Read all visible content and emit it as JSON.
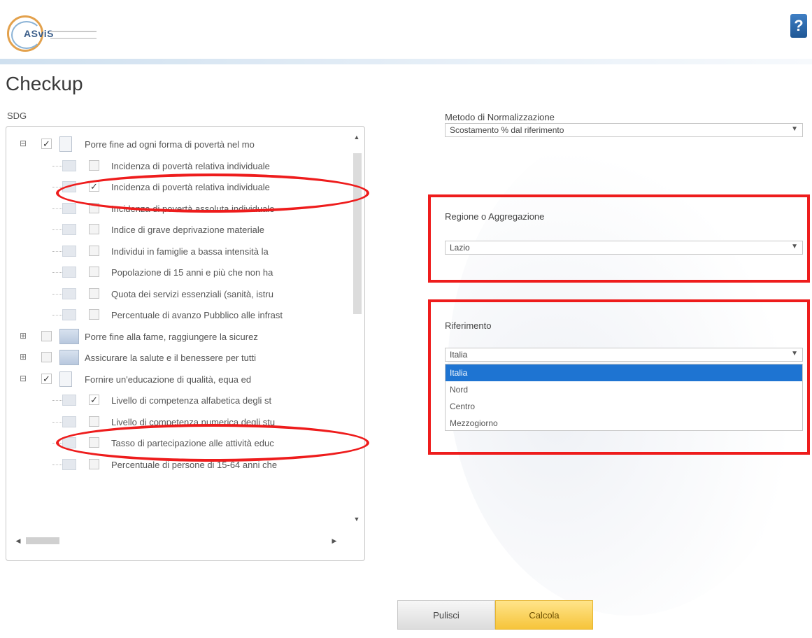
{
  "header": {
    "logo_text": "ASviS",
    "help_label": "?"
  },
  "page": {
    "title": "Checkup"
  },
  "tree": {
    "label": "SDG",
    "rows": [
      {
        "label": "Porre fine ad ogni forma di povertà nel mo",
        "checked": true,
        "type": "parent",
        "expander": "⊟"
      },
      {
        "label": "Incidenza di povertà relativa individuale",
        "checked": false,
        "type": "child"
      },
      {
        "label": "Incidenza di povertà relativa individuale",
        "checked": true,
        "type": "child"
      },
      {
        "label": "Incidenza di povertà assoluta individuale",
        "checked": false,
        "type": "child"
      },
      {
        "label": "Indice di grave deprivazione materiale",
        "checked": false,
        "type": "child"
      },
      {
        "label": "Individui in famiglie a bassa intensità la",
        "checked": false,
        "type": "child"
      },
      {
        "label": "Popolazione di 15 anni e più che non ha",
        "checked": false,
        "type": "child"
      },
      {
        "label": "Quota dei servizi essenziali (sanità, istru",
        "checked": false,
        "type": "child"
      },
      {
        "label": "Percentuale di avanzo Pubblico alle infrast",
        "checked": false,
        "type": "child"
      },
      {
        "label": "Porre fine alla fame, raggiungere la sicurez",
        "checked": false,
        "type": "parent",
        "expander": "⊞"
      },
      {
        "label": "Assicurare la salute e il benessere per tutti",
        "checked": false,
        "type": "parent",
        "expander": "⊞"
      },
      {
        "label": "Fornire un'educazione di qualità, equa ed",
        "checked": true,
        "type": "parent",
        "expander": "⊟"
      },
      {
        "label": "Livello di competenza alfabetica degli st",
        "checked": true,
        "type": "child"
      },
      {
        "label": "Livello di competenza numerica degli stu",
        "checked": false,
        "type": "child"
      },
      {
        "label": "Tasso di partecipazione alle attività educ",
        "checked": false,
        "type": "child"
      },
      {
        "label": "Percentuale di persone di 15-64 anni che",
        "checked": false,
        "type": "child"
      }
    ],
    "scroll_up": "▲",
    "scroll_down": "▼",
    "scroll_left": "◀",
    "scroll_right": "▶"
  },
  "normalization": {
    "label": "Metodo di Normalizzazione",
    "value": "Scostamento % dal riferimento",
    "arrow": "▼"
  },
  "region": {
    "label": "Regione o Aggregazione",
    "value": "Lazio",
    "arrow": "▼"
  },
  "reference": {
    "label": "Riferimento",
    "value": "Italia",
    "arrow": "▼",
    "options": [
      "Italia",
      "Nord",
      "Centro",
      "Mezzogiorno"
    ],
    "selected_index": 0
  },
  "buttons": {
    "reset_label": "Pulisci",
    "calc_label": "Calcola"
  },
  "colors": {
    "annotation_red": "#ee1c1c",
    "selection_blue": "#1e74d2",
    "calc_yellow": "#f6c43a"
  }
}
